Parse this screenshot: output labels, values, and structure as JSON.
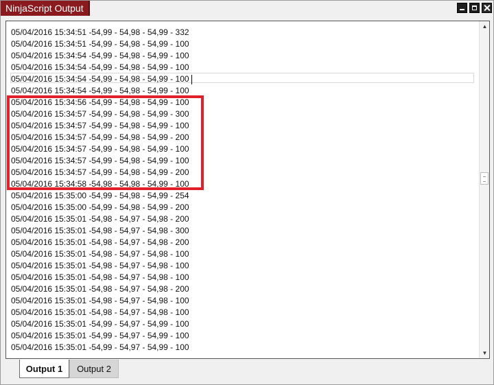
{
  "window": {
    "title": "NinjaScript Output"
  },
  "log": {
    "lines": [
      "05/04/2016 15:34:51 -54,99 - 54,98 - 54,99 - 332",
      "05/04/2016 15:34:51 -54,99 - 54,98 - 54,99 - 100",
      "05/04/2016 15:34:54 -54,99 - 54,98 - 54,99 - 100",
      "05/04/2016 15:34:54 -54,99 - 54,98 - 54,99 - 100",
      "05/04/2016 15:34:54 -54,99 - 54,98 - 54,99 - 100",
      "05/04/2016 15:34:54 -54,99 - 54,98 - 54,99 - 100",
      "05/04/2016 15:34:56 -54,99 - 54,98 - 54,99 - 100",
      "05/04/2016 15:34:57 -54,99 - 54,98 - 54,99 - 300",
      "05/04/2016 15:34:57 -54,99 - 54,98 - 54,99 - 100",
      "05/04/2016 15:34:57 -54,99 - 54,98 - 54,99 - 200",
      "05/04/2016 15:34:57 -54,99 - 54,98 - 54,99 - 100",
      "05/04/2016 15:34:57 -54,99 - 54,98 - 54,99 - 100",
      "05/04/2016 15:34:57 -54,99 - 54,98 - 54,99 - 200",
      "05/04/2016 15:34:58 -54,98 - 54,98 - 54,99 - 100",
      "05/04/2016 15:35:00 -54,99 - 54,98 - 54,99 - 254",
      "05/04/2016 15:35:00 -54,99 - 54,98 - 54,99 - 200",
      "05/04/2016 15:35:01 -54,98 - 54,97 - 54,98 - 200",
      "05/04/2016 15:35:01 -54,98 - 54,97 - 54,98 - 300",
      "05/04/2016 15:35:01 -54,98 - 54,97 - 54,98 - 200",
      "05/04/2016 15:35:01 -54,98 - 54,97 - 54,98 - 100",
      "05/04/2016 15:35:01 -54,98 - 54,97 - 54,98 - 100",
      "05/04/2016 15:35:01 -54,98 - 54,97 - 54,98 - 100",
      "05/04/2016 15:35:01 -54,98 - 54,97 - 54,98 - 200",
      "05/04/2016 15:35:01 -54,98 - 54,97 - 54,98 - 100",
      "05/04/2016 15:35:01 -54,98 - 54,97 - 54,98 - 100",
      "05/04/2016 15:35:01 -54,99 - 54,97 - 54,99 - 100",
      "05/04/2016 15:35:01 -54,99 - 54,97 - 54,99 - 100",
      "05/04/2016 15:35:01 -54,99 - 54,97 - 54,99 - 100"
    ]
  },
  "tabs": [
    {
      "label": "Output 1",
      "active": true
    },
    {
      "label": "Output 2",
      "active": false
    }
  ],
  "icons": {
    "minimize": "minimize-icon",
    "maximize": "maximize-icon",
    "close": "close-icon",
    "scroll_up": "scroll-up-arrow-icon",
    "scroll_down": "scroll-down-arrow-icon"
  },
  "colors": {
    "title_tab": "#8b1a1f",
    "highlight": "#e0202a"
  }
}
